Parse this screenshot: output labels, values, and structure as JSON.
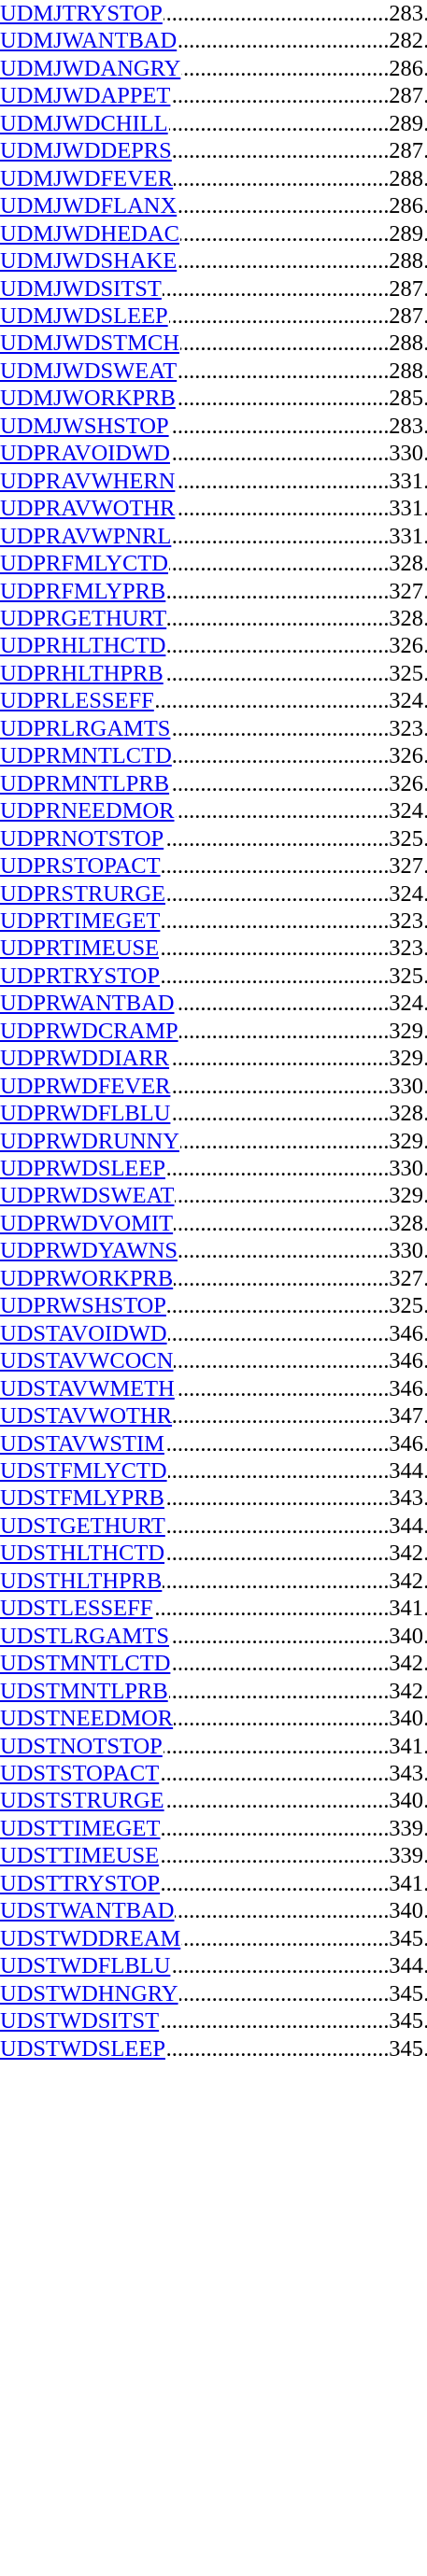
{
  "index": {
    "entries": [
      {
        "term": "UDMJTRYSTOP",
        "page": "283"
      },
      {
        "term": "UDMJWANTBAD",
        "page": "282"
      },
      {
        "term": "UDMJWDANGRY",
        "page": "286"
      },
      {
        "term": "UDMJWDAPPET",
        "page": "287"
      },
      {
        "term": "UDMJWDCHILL",
        "page": "289"
      },
      {
        "term": "UDMJWDDEPRS",
        "page": "287"
      },
      {
        "term": "UDMJWDFEVER",
        "page": "288"
      },
      {
        "term": "UDMJWDFLANX",
        "page": "286"
      },
      {
        "term": "UDMJWDHEDAC",
        "page": "289"
      },
      {
        "term": "UDMJWDSHAKE",
        "page": "288"
      },
      {
        "term": "UDMJWDSITST",
        "page": "287"
      },
      {
        "term": "UDMJWDSLEEP",
        "page": "287"
      },
      {
        "term": "UDMJWDSTMCH",
        "page": "288"
      },
      {
        "term": "UDMJWDSWEAT",
        "page": "288"
      },
      {
        "term": "UDMJWORKPRB",
        "page": "285"
      },
      {
        "term": "UDMJWSHSTOP",
        "page": "283"
      },
      {
        "term": "UDPRAVOIDWD",
        "page": "330"
      },
      {
        "term": "UDPRAVWHERN",
        "page": "331"
      },
      {
        "term": "UDPRAVWOTHR",
        "page": "331"
      },
      {
        "term": "UDPRAVWPNRL",
        "page": "331"
      },
      {
        "term": "UDPRFMLYCTD",
        "page": "328"
      },
      {
        "term": "UDPRFMLYPRB",
        "page": "327"
      },
      {
        "term": "UDPRGETHURT",
        "page": "328"
      },
      {
        "term": "UDPRHLTHCTD",
        "page": "326"
      },
      {
        "term": "UDPRHLTHPRB",
        "page": "325"
      },
      {
        "term": "UDPRLESSEFF",
        "page": "324"
      },
      {
        "term": "UDPRLRGAMTS",
        "page": "323"
      },
      {
        "term": "UDPRMNTLCTD",
        "page": "326"
      },
      {
        "term": "UDPRMNTLPRB",
        "page": "326"
      },
      {
        "term": "UDPRNEEDMOR",
        "page": "324"
      },
      {
        "term": "UDPRNOTSTOP",
        "page": "325"
      },
      {
        "term": "UDPRSTOPACT",
        "page": "327"
      },
      {
        "term": "UDPRSTRURGE",
        "page": "324"
      },
      {
        "term": "UDPRTIMEGET",
        "page": "323"
      },
      {
        "term": "UDPRTIMEUSE",
        "page": "323"
      },
      {
        "term": "UDPRTRYSTOP",
        "page": "325"
      },
      {
        "term": "UDPRWANTBAD",
        "page": "324"
      },
      {
        "term": "UDPRWDCRAMP",
        "page": "329"
      },
      {
        "term": "UDPRWDDIARR",
        "page": "329"
      },
      {
        "term": "UDPRWDFEVER",
        "page": "330"
      },
      {
        "term": "UDPRWDFLBLU",
        "page": "328"
      },
      {
        "term": "UDPRWDRUNNY",
        "page": "329"
      },
      {
        "term": "UDPRWDSLEEP",
        "page": "330"
      },
      {
        "term": "UDPRWDSWEAT",
        "page": "329"
      },
      {
        "term": "UDPRWDVOMIT",
        "page": "328"
      },
      {
        "term": "UDPRWDYAWNS",
        "page": "330"
      },
      {
        "term": "UDPRWORKPRB",
        "page": "327"
      },
      {
        "term": "UDPRWSHSTOP",
        "page": "325"
      },
      {
        "term": "UDSTAVOIDWD",
        "page": "346"
      },
      {
        "term": "UDSTAVWCOCN",
        "page": "346"
      },
      {
        "term": "UDSTAVWMETH",
        "page": "346"
      },
      {
        "term": "UDSTAVWOTHR",
        "page": "347"
      },
      {
        "term": "UDSTAVWSTIM",
        "page": "346"
      },
      {
        "term": "UDSTFMLYCTD",
        "page": "344"
      },
      {
        "term": "UDSTFMLYPRB",
        "page": "343"
      },
      {
        "term": "UDSTGETHURT",
        "page": "344"
      },
      {
        "term": "UDSTHLTHCTD",
        "page": "342"
      },
      {
        "term": "UDSTHLTHPRB",
        "page": "342"
      },
      {
        "term": "UDSTLESSEFF",
        "page": "341"
      },
      {
        "term": "UDSTLRGAMTS",
        "page": "340"
      },
      {
        "term": "UDSTMNTLCTD",
        "page": "342"
      },
      {
        "term": "UDSTMNTLPRB",
        "page": "342"
      },
      {
        "term": "UDSTNEEDMOR",
        "page": "340"
      },
      {
        "term": "UDSTNOTSTOP",
        "page": "341"
      },
      {
        "term": "UDSTSTOPACT",
        "page": "343"
      },
      {
        "term": "UDSTSTRURGE",
        "page": "340"
      },
      {
        "term": "UDSTTIMEGET",
        "page": "339"
      },
      {
        "term": "UDSTTIMEUSE",
        "page": "339"
      },
      {
        "term": "UDSTTRYSTOP",
        "page": "341"
      },
      {
        "term": "UDSTWANTBAD",
        "page": "340"
      },
      {
        "term": "UDSTWDDREAM",
        "page": "345"
      },
      {
        "term": "UDSTWDFLBLU",
        "page": "344"
      },
      {
        "term": "UDSTWDHNGRY",
        "page": "345"
      },
      {
        "term": "UDSTWDSITST",
        "page": "345"
      },
      {
        "term": "UDSTWDSLEEP",
        "page": "345"
      }
    ]
  },
  "colors": {
    "link": "#0000ee",
    "text": "#000000",
    "background": "#ffffff"
  }
}
